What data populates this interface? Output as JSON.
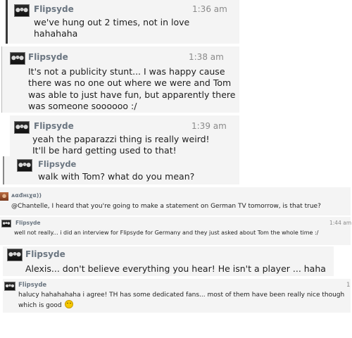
{
  "messages": [
    {
      "name": "Flipsyde",
      "time": "1:36 am",
      "text": "we've hung out 2 times, not in love hahahaha"
    },
    {
      "name": "Flipsyde",
      "time": "1:38 am",
      "text": "It's not a publicity stunt... I was happy cause there was no one out where we were and Tom was able to just have fun, but apparently there was someone soooooo :/"
    },
    {
      "name": "Flipsyde",
      "time": "1:39 am",
      "text": "yeah the paparazzi thing is really weird! It'll be hard getting used to that!"
    },
    {
      "name": "Flipsyde",
      "time": "",
      "text": "walk with Tom? what do you mean?"
    },
    {
      "name": "ᴀαđнιχα))",
      "time": "",
      "text": "@Chantelle, I heard that you're going to make a statement on German TV tomorrow, is that true?"
    },
    {
      "name": "Flipsyde",
      "time": "1:44 am",
      "text": "well not really... i did an interview for Flipsyde for Germany and they just asked about Tom the whole time :/"
    },
    {
      "name": "Flipsyde",
      "time": "",
      "text": "Alexis... don't believe everything you hear! He isn't a player ... haha"
    },
    {
      "name": "Flipsyde",
      "time": "1",
      "text": "halucy hahahahaha i agree! TH has some dedicated fans... most of them have been really nice though which is good"
    }
  ],
  "icons": {
    "avatar": "group-photo-avatar",
    "avatar_alt": "user-photo-avatar",
    "smiley": "smiley-emoji-icon"
  }
}
